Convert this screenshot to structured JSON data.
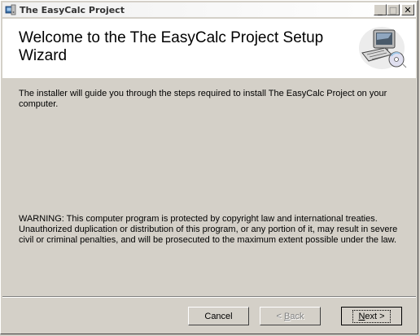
{
  "window": {
    "title": "The EasyCalc Project",
    "minimize_glyph": "_",
    "maximize_glyph": "□",
    "close_glyph": "✕"
  },
  "banner": {
    "title": "Welcome to the The EasyCalc Project  Setup Wizard"
  },
  "body": {
    "intro": "The installer will guide you through the steps required to install The EasyCalc Project  on your computer.",
    "warning": "WARNING: This computer program is protected by copyright law and international treaties. Unauthorized duplication or distribution of this program, or any portion of it, may result in severe civil or criminal penalties, and will be prosecuted to the maximum extent possible under the law."
  },
  "buttons": {
    "cancel": "Cancel",
    "back_mnemonic": "B",
    "back_rest": "ack",
    "back_prefix": "< ",
    "next_mnemonic": "N",
    "next_rest": "ext >"
  }
}
